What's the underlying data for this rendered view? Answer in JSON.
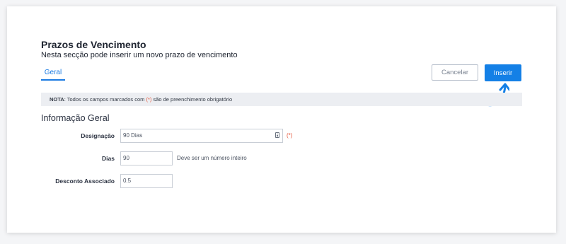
{
  "header": {
    "title": "Prazos de Vencimento",
    "subtitle": "Nesta secção pode inserir um novo prazo de vencimento"
  },
  "tabs": [
    {
      "label": "Geral",
      "active": true
    }
  ],
  "actions": {
    "cancel_label": "Cancelar",
    "insert_label": "Inserir"
  },
  "note": {
    "prefix": "NOTA",
    "text_before": ": Todos os campos marcados com ",
    "required_marker": "(*)",
    "text_after": " são de preenchimento obrigatório"
  },
  "section_title": "Informação Geral",
  "fields": {
    "designacao": {
      "label": "Designação",
      "value": "90 Dias",
      "required_marker": "(*)",
      "icon": "list-icon"
    },
    "dias": {
      "label": "Dias",
      "value": "90",
      "hint": "Deve ser um número inteiro"
    },
    "desconto": {
      "label": "Desconto Associado",
      "value": "0.5"
    }
  },
  "colors": {
    "accent": "#1480e6",
    "required": "#e5563a",
    "note_background": "#eceef2"
  }
}
